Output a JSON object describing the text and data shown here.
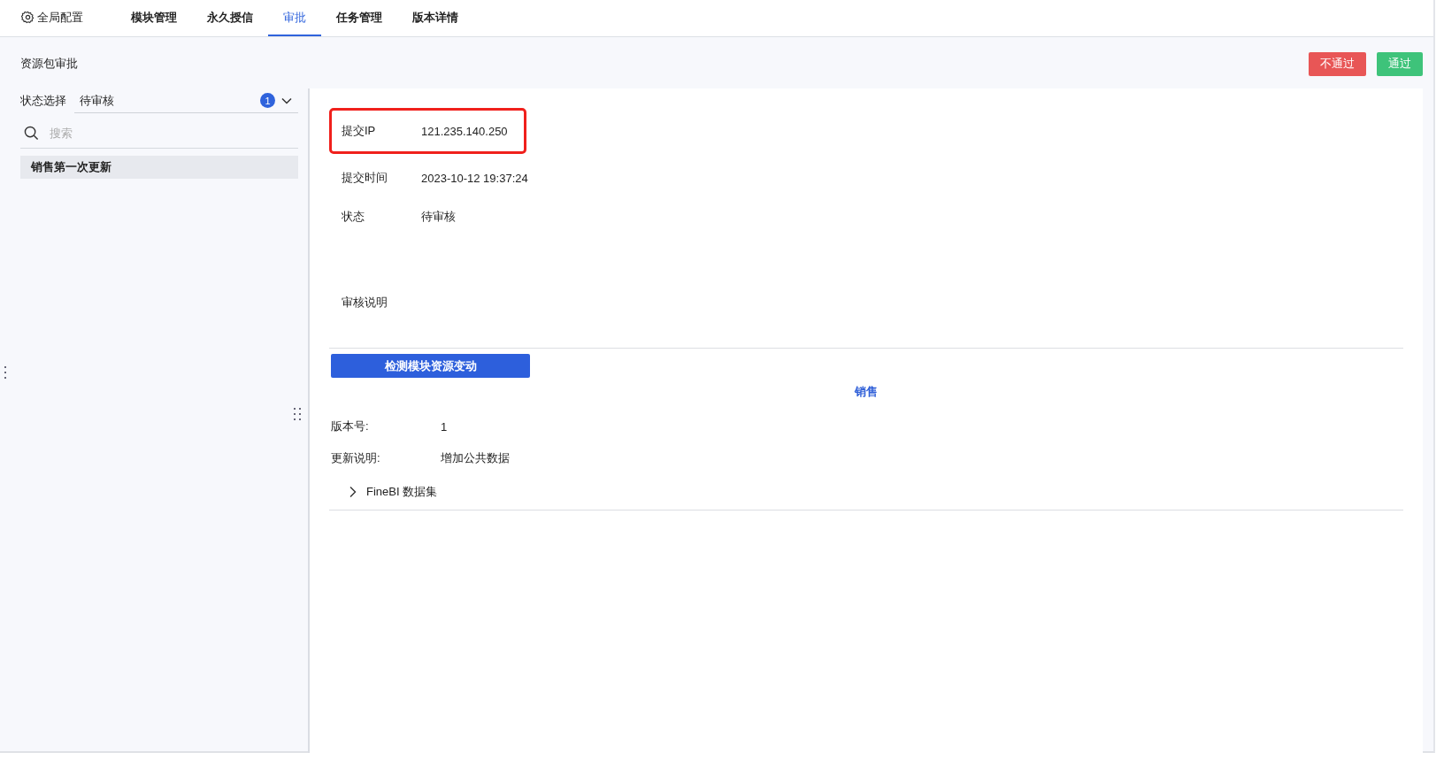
{
  "tabs": [
    {
      "label": "全局配置",
      "kind": "settings",
      "selected": false
    },
    {
      "label": "模块管理",
      "kind": "plain",
      "selected": false
    },
    {
      "label": "永久授信",
      "kind": "plain",
      "selected": false
    },
    {
      "label": "审批",
      "kind": "plain",
      "selected": true
    },
    {
      "label": "任务管理",
      "kind": "plain",
      "selected": false
    },
    {
      "label": "版本详情",
      "kind": "plain",
      "selected": false
    }
  ],
  "page_title": "资源包审批",
  "actions": [
    {
      "label": "不通过",
      "kind": "reject"
    },
    {
      "label": "通过",
      "kind": "approve"
    }
  ],
  "sidebar": {
    "status_label": "状态选择",
    "status_value": "待审核",
    "status_count": "1",
    "search": {
      "placeholder": "搜索"
    },
    "items": [
      {
        "label": "销售第一次更新",
        "selected": true
      }
    ]
  },
  "details": [
    {
      "label": "提交IP",
      "value": "121.235.140.250",
      "highlighted": true
    },
    {
      "label": "提交时间",
      "value": "2023-10-12 19:37:24",
      "highlighted": false
    },
    {
      "label": "状态",
      "value": "待审核",
      "highlighted": false
    }
  ],
  "review_note_label": "审核说明",
  "check_button": "检测模块资源变动",
  "module_name": "销售",
  "version_fields": [
    {
      "label": "版本号:",
      "value": "1"
    },
    {
      "label": "更新说明:",
      "value": "增加公共数据"
    }
  ],
  "tree": [
    {
      "label": "FineBI 数据集",
      "expanded": false
    }
  ]
}
